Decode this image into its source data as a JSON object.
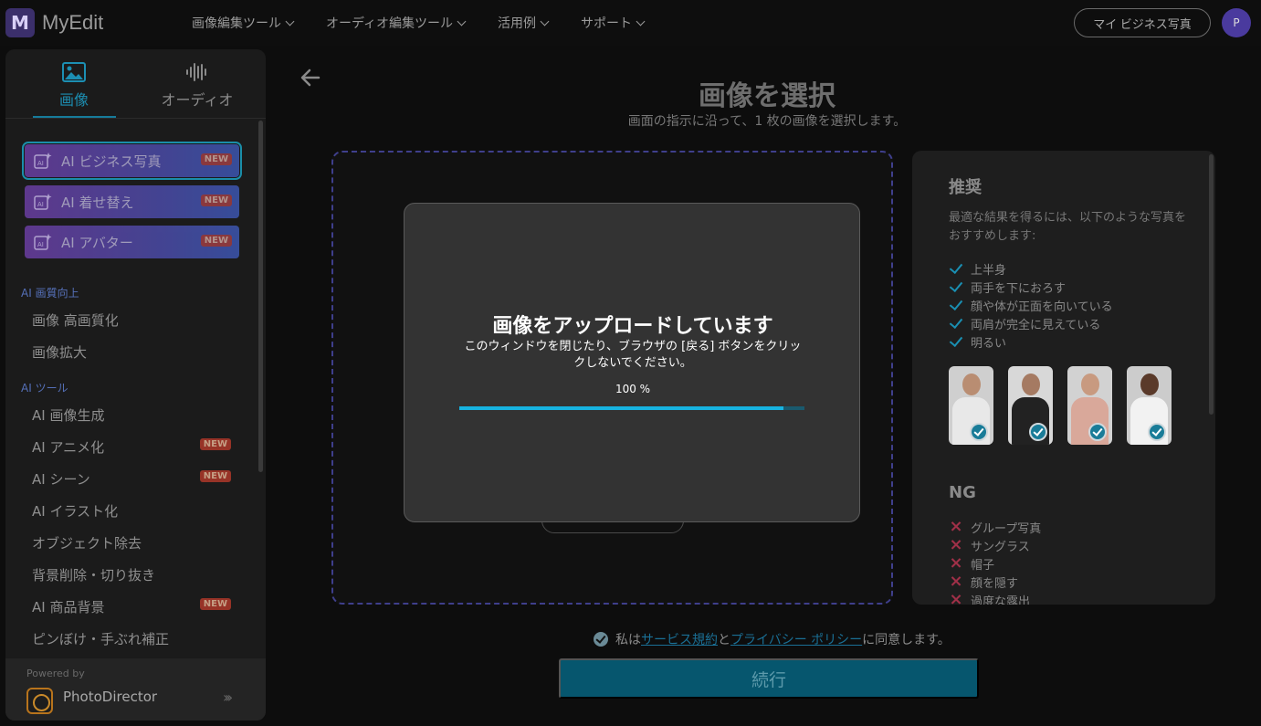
{
  "app": {
    "logo_letter": "M",
    "name": "MyEdit"
  },
  "nav": {
    "items": [
      {
        "label": "画像編集ツール"
      },
      {
        "label": "オーディオ編集ツール"
      },
      {
        "label": "活用例"
      },
      {
        "label": "サポート"
      }
    ],
    "my_business_photo": "マイ ビジネス写真",
    "avatar_letter": "P"
  },
  "sidebar": {
    "tabs": [
      {
        "label": "画像",
        "icon": "image-icon",
        "active": true
      },
      {
        "label": "オーディオ",
        "icon": "waveform-icon",
        "active": false
      }
    ],
    "promo_buttons": [
      {
        "label": "AI ビジネス写真",
        "badge": "NEW",
        "active": true
      },
      {
        "label": "AI 着せ替え",
        "badge": "NEW"
      },
      {
        "label": "AI アバター",
        "badge": "NEW"
      }
    ],
    "sections": [
      {
        "label": "AI 画質向上",
        "items": [
          {
            "label": "画像 高画質化"
          },
          {
            "label": "画像拡大"
          }
        ]
      },
      {
        "label": "AI ツール",
        "items": [
          {
            "label": "AI 画像生成"
          },
          {
            "label": "AI アニメ化",
            "badge": "NEW"
          },
          {
            "label": "AI シーン",
            "badge": "NEW"
          },
          {
            "label": "AI イラスト化"
          },
          {
            "label": "オブジェクト除去"
          },
          {
            "label": "背景削除・切り抜き"
          },
          {
            "label": "AI 商品背景",
            "badge": "NEW"
          },
          {
            "label": "ピンぼけ・手ぶれ補正"
          }
        ]
      }
    ],
    "powered_by": "Powered by",
    "powered_product": "PhotoDirector"
  },
  "main": {
    "title": "画像を選択",
    "subtitle": "画面の指示に沿って、1 枚の画像を選択します。"
  },
  "recommend": {
    "heading": "推奨",
    "description": "最適な結果を得るには、以下のような写真をおすすめします:",
    "ok_items": [
      "上半身",
      "両手を下におろす",
      "顔や体が正面を向いている",
      "両肩が完全に見えている",
      "明るい"
    ],
    "ng_heading": "NG",
    "ng_items": [
      "グループ写真",
      "サングラス",
      "帽子",
      "顔を隠す",
      "過度な露出"
    ]
  },
  "agreement": {
    "prefix": "私は",
    "terms_link": "サービス規約",
    "middle": "と",
    "privacy_link": "プライバシー ポリシー",
    "suffix": "に同意します。"
  },
  "continue_label": "続行",
  "upload_modal": {
    "title": "画像をアップロードしています",
    "description": "このウィンドウを閉じたり、ブラウザの [戻る] ボタンをクリックしないでください。",
    "percent_text": "100 %",
    "progress": 0.94
  },
  "colors": {
    "accent": "#17b3e0",
    "brand": "#3b2f6b",
    "ng": "#a03048"
  }
}
